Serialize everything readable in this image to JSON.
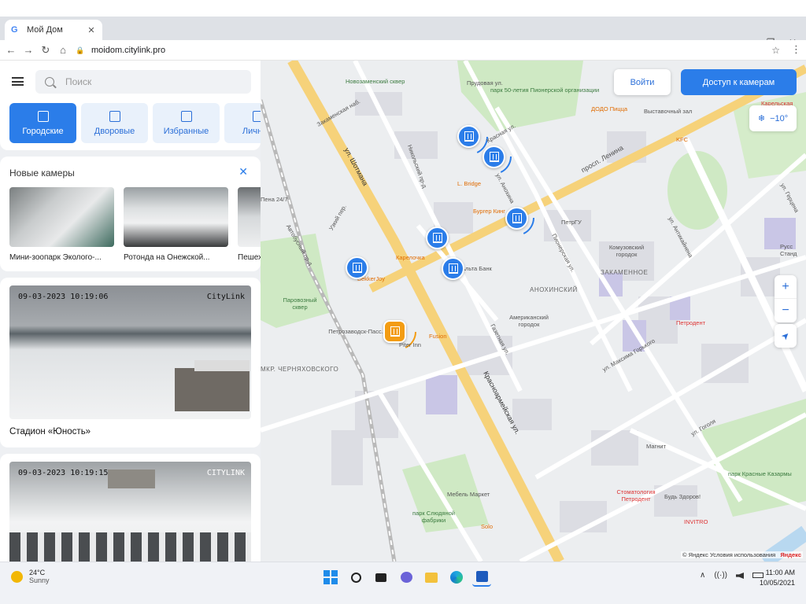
{
  "browser": {
    "tab_title": "Мой Дом",
    "tab_favicon": "G",
    "url": "moidom.citylink.pro",
    "icons": {
      "back": "←",
      "forward": "→",
      "reload": "↻",
      "home": "⌂",
      "close_tab": "✕",
      "new_tab": "+",
      "bookmark": "☆",
      "menu": "⋮",
      "lock": "🔒",
      "chevron": "⌄",
      "minimize": "—",
      "restore": "❐",
      "close_window": "✕"
    }
  },
  "sidebar": {
    "search_placeholder": "Поиск",
    "categories": [
      {
        "label": "Городские",
        "active": true
      },
      {
        "label": "Дворовые",
        "active": false
      },
      {
        "label": "Избранные",
        "active": false
      },
      {
        "label": "Личные",
        "active": false
      }
    ],
    "new_cameras_title": "Новые камеры",
    "close_icon": "✕",
    "new_cameras": [
      {
        "caption": "Мини-зоопарк Эколого-..."
      },
      {
        "caption": "Ротонда на Онежской..."
      },
      {
        "caption": "Пешеходная..."
      }
    ],
    "feed": [
      {
        "timestamp": "09-03-2023 10:19:06",
        "brand": "CityLink",
        "caption": "Стадион «Юность»"
      },
      {
        "timestamp": "09-03-2023 10:19:15",
        "brand": "CITYLINK",
        "caption": ""
      }
    ]
  },
  "map": {
    "login_label": "Войти",
    "cams_access_label": "Доступ к камерам",
    "weather": {
      "icon": "❄",
      "value": "−10°"
    },
    "zoom_in": "+",
    "zoom_out": "−",
    "locate_icon": "➤",
    "attribution": "© Яндекс Условия использования",
    "yandex": "Яндекс",
    "labels": [
      {
        "text": "Новозаменский сквер",
        "cls": "green"
      },
      {
        "text": "парк 50-летия Пионерской организации",
        "cls": "green"
      },
      {
        "text": "Прудовая ул.",
        "cls": ""
      },
      {
        "text": "Закаменская наб.",
        "cls": ""
      },
      {
        "text": "Никольский пр-д",
        "cls": ""
      },
      {
        "text": "ул. Шотмана",
        "cls": ""
      },
      {
        "text": "Красная ул.",
        "cls": ""
      },
      {
        "text": "ул. Анохина",
        "cls": ""
      },
      {
        "text": "L. Bridge",
        "cls": "orange"
      },
      {
        "text": "Бургер Кинг",
        "cls": "orange"
      },
      {
        "text": "просп. Ленина",
        "cls": ""
      },
      {
        "text": "ПетрГУ",
        "cls": ""
      },
      {
        "text": "Карелочка",
        "cls": "orange"
      },
      {
        "text": "BekkerJoy",
        "cls": "orange"
      },
      {
        "text": "Альта Банк",
        "cls": ""
      },
      {
        "text": "Пена 24/7",
        "cls": ""
      },
      {
        "text": "Узкий пер.",
        "cls": ""
      },
      {
        "text": "Паровозный сквер",
        "cls": "green"
      },
      {
        "text": "Автобусный пр-д",
        "cls": ""
      },
      {
        "text": "Петрозаводск-Пасс.",
        "cls": ""
      },
      {
        "text": "Piter Inn",
        "cls": ""
      },
      {
        "text": "Fusion",
        "cls": "orange"
      },
      {
        "text": "МКР. ЧЕРНЯХОВСКОГО",
        "cls": "district"
      },
      {
        "text": "АНОХИНСКИЙ",
        "cls": "district"
      },
      {
        "text": "ЗАКАМЕННОЕ",
        "cls": "district"
      },
      {
        "text": "Комузовский городок",
        "cls": ""
      },
      {
        "text": "Американский городок",
        "cls": ""
      },
      {
        "text": "Пионерская ул.",
        "cls": ""
      },
      {
        "text": "ул. Максима Горького",
        "cls": ""
      },
      {
        "text": "ул. Антикайнена",
        "cls": ""
      },
      {
        "text": "Красноармейская ул.",
        "cls": ""
      },
      {
        "text": "Газетная ул.",
        "cls": ""
      },
      {
        "text": "ДОДО Пицца",
        "cls": "orange"
      },
      {
        "text": "Выставочный зал",
        "cls": ""
      },
      {
        "text": "KFC",
        "cls": "orange"
      },
      {
        "text": "Карельская",
        "cls": "red"
      },
      {
        "text": "Петродент",
        "cls": "red"
      },
      {
        "text": "Магнит",
        "cls": ""
      },
      {
        "text": "Мебель Маркет",
        "cls": ""
      },
      {
        "text": "парк Слюдяной фабрики",
        "cls": "green"
      },
      {
        "text": "Solo",
        "cls": "orange"
      },
      {
        "text": "Стоматология Петродент",
        "cls": "red"
      },
      {
        "text": "Будь Здоров!",
        "cls": ""
      },
      {
        "text": "INVITRO",
        "cls": "red"
      },
      {
        "text": "парк Красные Казармы",
        "cls": "green"
      },
      {
        "text": "ул. Гоголя",
        "cls": ""
      },
      {
        "text": "Русс Станд",
        "cls": ""
      },
      {
        "text": "ул. Герцена",
        "cls": ""
      }
    ]
  },
  "taskbar": {
    "weather_temp": "24°C",
    "weather_desc": "Sunny",
    "time": "11:00 AM",
    "date": "10/05/2021",
    "tray_chevron": "∧",
    "apps": [
      "start-icon",
      "search-icon",
      "task-view-icon",
      "chat-icon",
      "file-explorer-icon",
      "edge-icon",
      "store-icon"
    ],
    "colors": {
      "accent": "#2b7de9",
      "sun": "#f2b705"
    }
  }
}
